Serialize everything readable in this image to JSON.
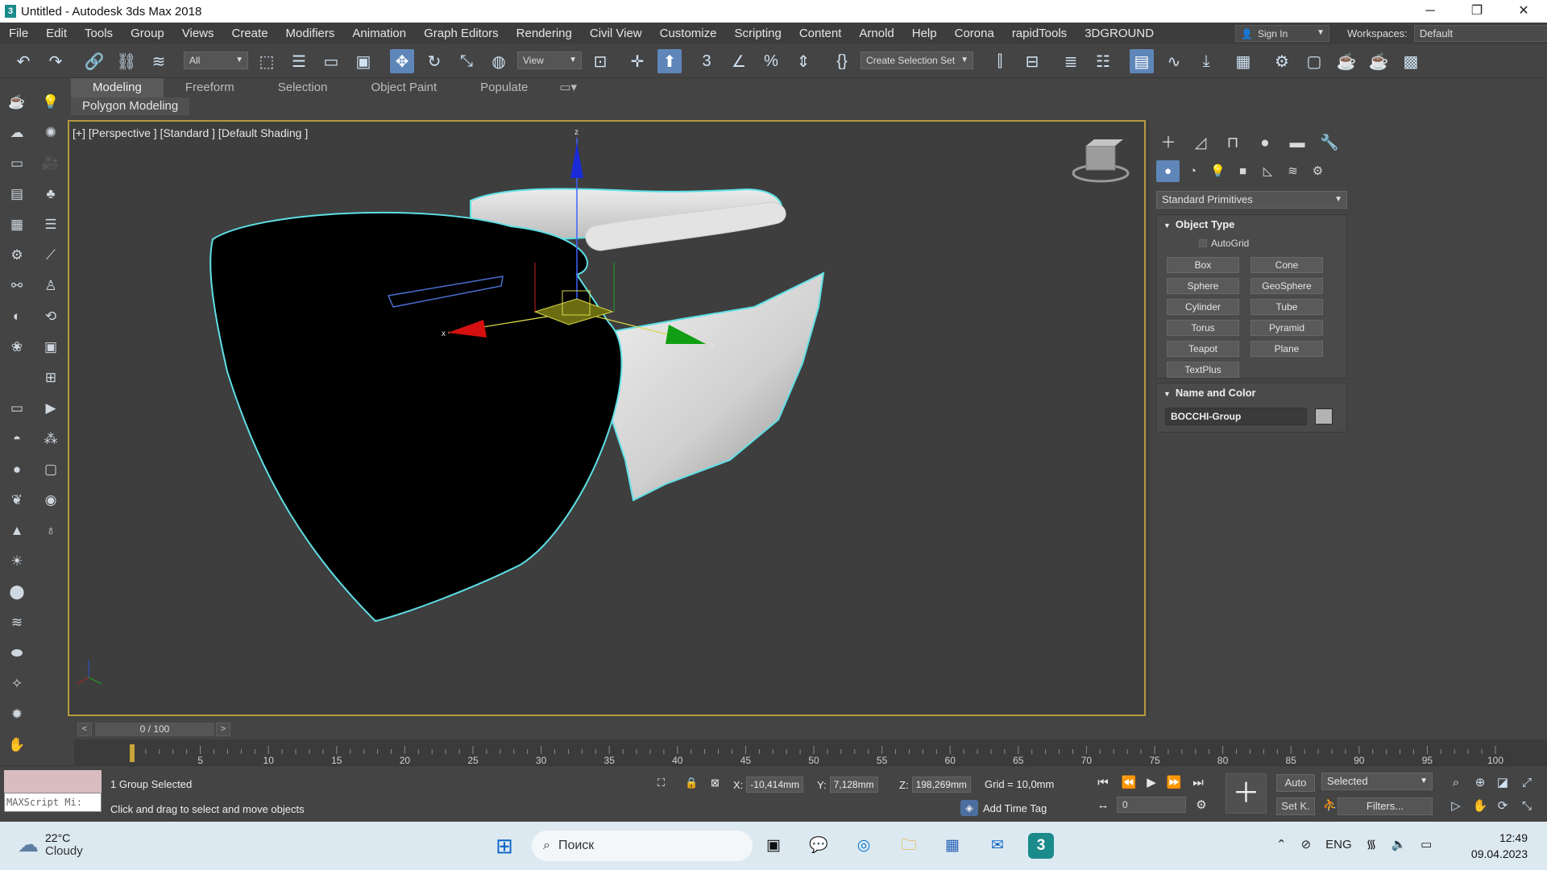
{
  "titlebar": {
    "title": "Untitled - Autodesk 3ds Max 2018",
    "minimize": "─",
    "maximize": "❐",
    "close": "✕"
  },
  "menu": [
    "File",
    "Edit",
    "Tools",
    "Group",
    "Views",
    "Create",
    "Modifiers",
    "Animation",
    "Graph Editors",
    "Rendering",
    "Civil View",
    "Customize",
    "Scripting",
    "Content",
    "Arnold",
    "Help",
    "Corona",
    "rapidTools",
    "3DGROUND"
  ],
  "signin": {
    "label": "Sign In"
  },
  "workspaces": {
    "label": "Workspaces:",
    "value": "Default"
  },
  "toolbar": {
    "filter": "All",
    "refcoord": "View",
    "selection_set": "Create Selection Set"
  },
  "ribbon": {
    "tabs": [
      "Modeling",
      "Freeform",
      "Selection",
      "Object Paint",
      "Populate"
    ],
    "active_tab": "Modeling",
    "subtab": "Polygon Modeling"
  },
  "viewport": {
    "label": "[+] [Perspective ] [Standard ] [Default Shading ]",
    "active_border": "#b59a3c",
    "selection_color": "#5ee0e6",
    "axes": {
      "x": "x",
      "y": "y",
      "z": "z"
    }
  },
  "cmdpanel": {
    "category": "Standard Primitives",
    "object_type": {
      "title": "Object Type",
      "autogrid": "AutoGrid",
      "buttons": [
        "Box",
        "Cone",
        "Sphere",
        "GeoSphere",
        "Cylinder",
        "Tube",
        "Torus",
        "Pyramid",
        "Teapot",
        "Plane",
        "TextPlus"
      ]
    },
    "name_color": {
      "title": "Name and Color",
      "name": "BOCCHI-Group",
      "swatch": "#b3b3b3"
    }
  },
  "timeline": {
    "slider_text": "0 / 100",
    "prev": "<",
    "next": ">",
    "ticks": [
      "5",
      "10",
      "15",
      "20",
      "25",
      "30",
      "35",
      "40",
      "45",
      "50",
      "55",
      "60",
      "65",
      "70",
      "75",
      "80",
      "85",
      "90",
      "95",
      "100"
    ]
  },
  "status": {
    "maxscript": "MAXScript Mi:",
    "selected": "1 Group Selected",
    "prompt": "Click and drag to select and move objects",
    "x_label": "X:",
    "x": "-10,414mm",
    "y_label": "Y:",
    "y": "7,128mm",
    "z_label": "Z:",
    "z": "198,269mm",
    "grid": "Grid = 10,0mm",
    "add_time_tag": "Add Time Tag",
    "frame": "0",
    "auto": "Auto",
    "setk": "Set K.",
    "selected_dd": "Selected",
    "filters": "Filters..."
  },
  "taskbar": {
    "weather_temp": "22°C",
    "weather_desc": "Cloudy",
    "search_placeholder": "Поиск",
    "lang": "ENG",
    "time": "12:49",
    "date": "09.04.2023"
  }
}
